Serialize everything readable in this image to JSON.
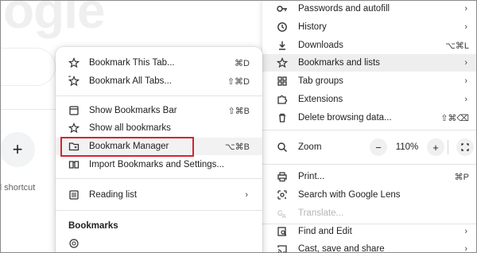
{
  "background": {
    "logo_text": "ogle",
    "add_button_glyph": "+",
    "add_label": "d shortcut"
  },
  "main_menu": {
    "items": [
      {
        "label": "Passwords and autofill",
        "icon": "key-icon",
        "chevron": "›"
      },
      {
        "label": "History",
        "icon": "history-icon",
        "chevron": "›"
      },
      {
        "label": "Downloads",
        "icon": "download-icon",
        "shortcut": "⌥⌘L"
      },
      {
        "label": "Bookmarks and lists",
        "icon": "star-icon",
        "chevron": "›"
      },
      {
        "label": "Tab groups",
        "icon": "tab-groups-icon",
        "chevron": "›"
      },
      {
        "label": "Extensions",
        "icon": "puzzle-icon",
        "chevron": "›"
      },
      {
        "label": "Delete browsing data...",
        "icon": "trash-icon",
        "shortcut": "⇧⌘⌫"
      },
      {
        "label": "Zoom",
        "icon": "zoom-icon"
      },
      {
        "label": "Print...",
        "icon": "print-icon",
        "shortcut": "⌘P"
      },
      {
        "label": "Search with Google Lens",
        "icon": "lens-icon"
      },
      {
        "label": "Translate...",
        "icon": "translate-icon"
      },
      {
        "label": "Find and Edit",
        "icon": "find-icon",
        "chevron": "›"
      },
      {
        "label": "Cast, save and share",
        "icon": "cast-icon",
        "chevron": "›"
      }
    ],
    "zoom": {
      "minus": "−",
      "value": "110%",
      "plus": "+"
    }
  },
  "bookmarks_submenu": {
    "items": [
      {
        "label": "Bookmark This Tab...",
        "icon": "star-icon",
        "shortcut": "⌘D"
      },
      {
        "label": "Bookmark All Tabs...",
        "icon": "star-all-icon",
        "shortcut": "⇧⌘D"
      },
      {
        "label": "Show Bookmarks Bar",
        "icon": "bookmarks-bar-icon",
        "shortcut": "⇧⌘B"
      },
      {
        "label": "Show all bookmarks",
        "icon": "star-outline-icon"
      },
      {
        "label": "Bookmark Manager",
        "icon": "folder-icon",
        "shortcut": "⌥⌘B"
      },
      {
        "label": "Import Bookmarks and Settings...",
        "icon": "import-icon"
      },
      {
        "label": "Reading list",
        "icon": "reading-list-icon",
        "chevron": "›"
      }
    ],
    "heading": "Bookmarks"
  },
  "colors": {
    "highlight_box": "#d7232f",
    "hover_row": "#eeeeee"
  }
}
